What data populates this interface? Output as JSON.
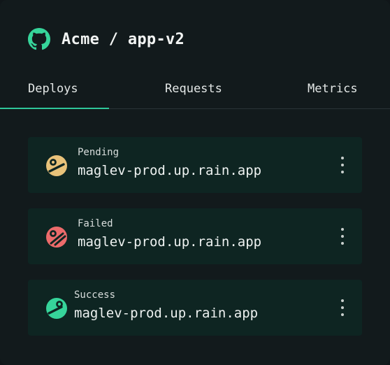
{
  "repo": {
    "title": "Acme / app-v2"
  },
  "tabs": [
    {
      "label": "Deploys"
    },
    {
      "label": "Requests"
    },
    {
      "label": "Metrics"
    }
  ],
  "active_tab": "Deploys",
  "deploys": [
    {
      "status": "Pending",
      "url": "maglev-prod.up.rain.app",
      "icon": "pending-icon",
      "color": "#e8c27a"
    },
    {
      "status": "Failed",
      "url": "maglev-prod.up.rain.app",
      "icon": "failed-icon",
      "color": "#ec6b6b"
    },
    {
      "status": "Success",
      "url": "maglev-prod.up.rain.app",
      "icon": "success-icon",
      "color": "#36d49a"
    }
  ],
  "colors": {
    "accent": "#2fc79a",
    "card_bg": "#121a1c",
    "row_bg": "#0e2522"
  }
}
